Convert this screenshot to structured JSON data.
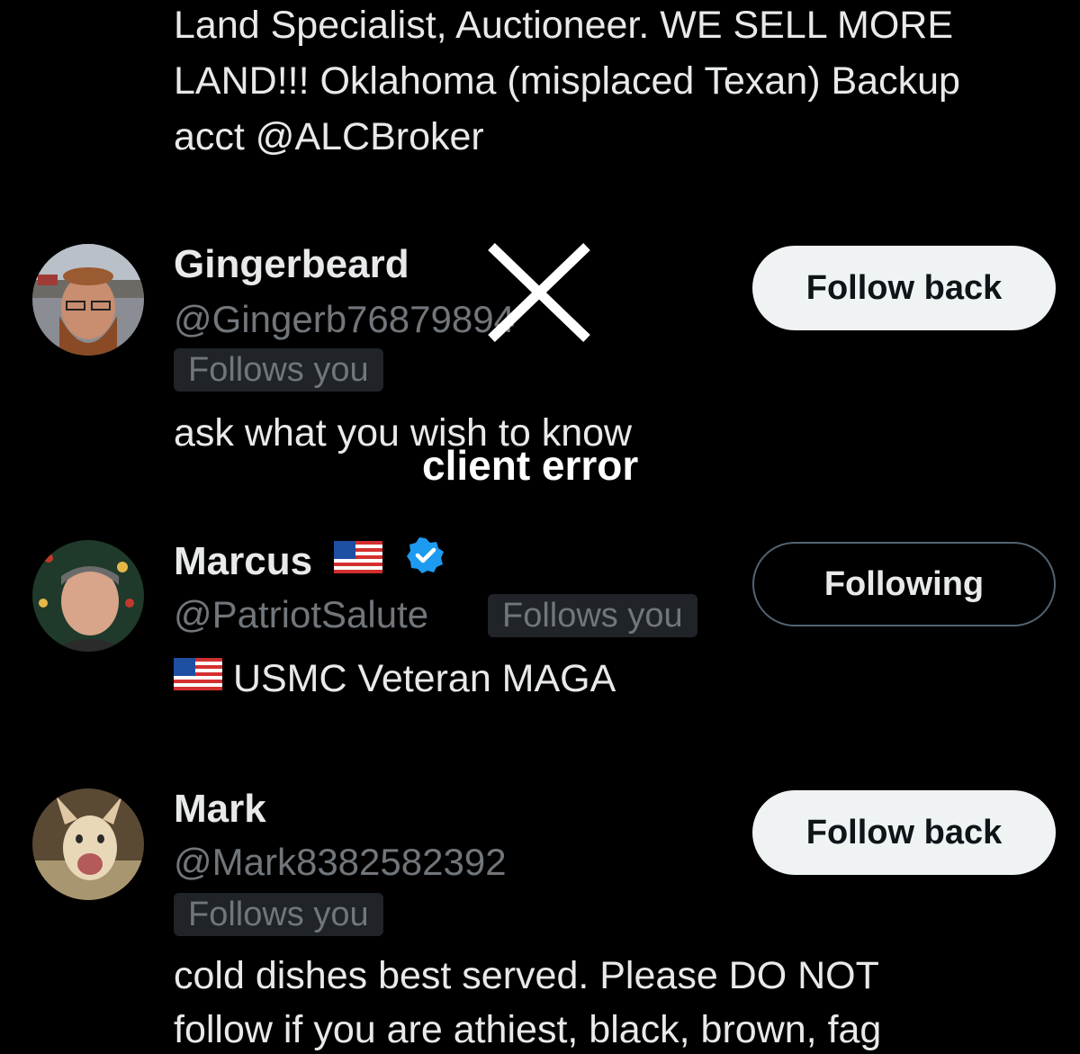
{
  "top_bio": {
    "line1": "Land Specialist, Auctioneer. WE SELL MORE",
    "line2": "LAND!!! Oklahoma (misplaced Texan) Backup",
    "line3": "acct @ALCBroker"
  },
  "users": [
    {
      "display_name": "Gingerbeard",
      "handle": "@Gingerb76879894",
      "follows_you": "Follows you",
      "bio": "ask what you wish to know",
      "button_label": "Follow back"
    },
    {
      "display_name": "Marcus",
      "handle": "@PatriotSalute",
      "follows_you": "Follows you",
      "bio": "USMC Veteran MAGA",
      "button_label": "Following"
    },
    {
      "display_name": "Mark",
      "handle": "@Mark8382582392",
      "follows_you": "Follows you",
      "bio_line1": "cold dishes best served. Please DO NOT",
      "bio_line2": "follow if you are athiest, black, brown, fag",
      "button_label": "Follow back"
    }
  ],
  "overlay": {
    "error_text": "client error"
  },
  "colors": {
    "background": "#000000",
    "text_primary": "#e7e9ea",
    "text_secondary": "#71767b",
    "verified_blue": "#1d9bf0",
    "follow_button_bg": "#eff3f4"
  }
}
